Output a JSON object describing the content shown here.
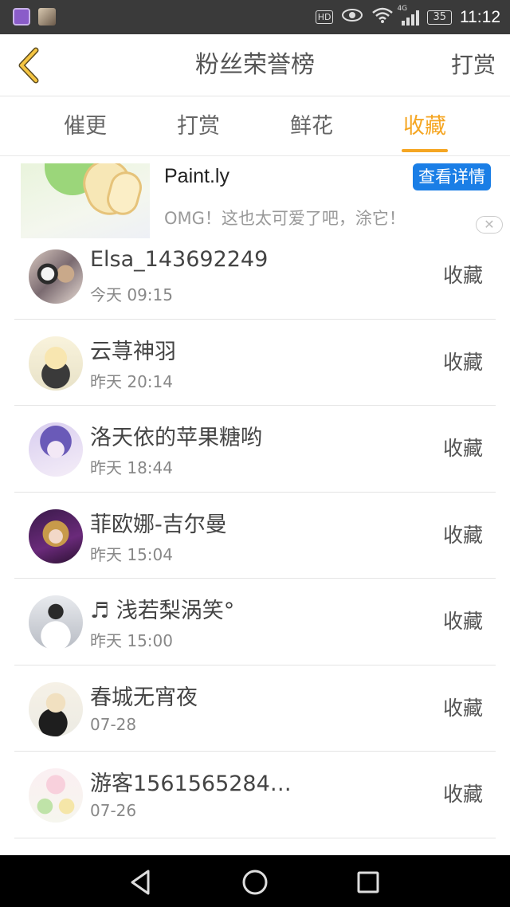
{
  "status_bar": {
    "hd": "HD",
    "network": "4G",
    "battery": "35",
    "time": "11:12"
  },
  "header": {
    "title": "粉丝荣誉榜",
    "action": "打赏"
  },
  "tabs": [
    {
      "label": "催更",
      "active": false
    },
    {
      "label": "打赏",
      "active": false
    },
    {
      "label": "鲜花",
      "active": false
    },
    {
      "label": "收藏",
      "active": true
    }
  ],
  "ad": {
    "title": "Paint.ly",
    "cta": "查看详情",
    "description": "OMG！这也太可爱了吧，涂它！",
    "close": "✕"
  },
  "list": [
    {
      "name": "Elsa_143692249",
      "time": "今天 09:15",
      "action": "收藏"
    },
    {
      "name": "云荨神羽",
      "time": "昨天 20:14",
      "action": "收藏"
    },
    {
      "name": "洛天依的苹果糖哟",
      "time": "昨天 18:44",
      "action": "收藏"
    },
    {
      "name": "菲欧娜-吉尔曼",
      "time": "昨天 15:04",
      "action": "收藏"
    },
    {
      "name": "♬ 浅若梨涡笑°",
      "time": "昨天 15:00",
      "action": "收藏"
    },
    {
      "name": "春城无宵夜",
      "time": "07-28",
      "action": "收藏"
    },
    {
      "name": "游客1561565284…",
      "time": "07-26",
      "action": "收藏"
    }
  ],
  "colors": {
    "accent": "#f5a623",
    "cta": "#1a7ee6"
  }
}
